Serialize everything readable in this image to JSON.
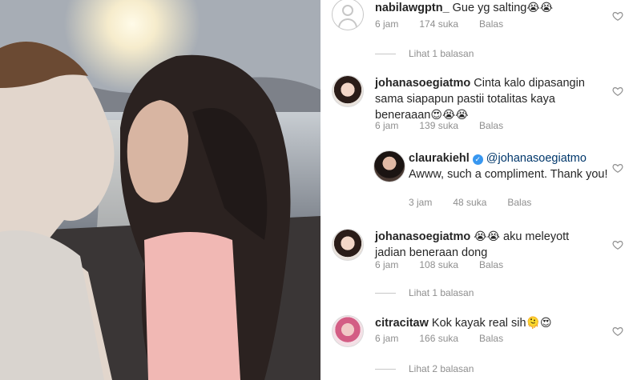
{
  "comments": [
    {
      "username": "nabilawgptn_",
      "text": "Gue yg salting",
      "emoji": "😭😭",
      "time": "6 jam",
      "likes": "174 suka",
      "reply": "Balas",
      "view_replies": "Lihat 1 balasan"
    },
    {
      "username": "johanasoegiatmo",
      "text": "Cinta kalo dipasangin sama siapapun pastii totalitas kaya beneraaan",
      "emoji": "😍😭😭",
      "time": "6 jam",
      "likes": "139 suka",
      "reply": "Balas"
    },
    {
      "username": "claurakiehl",
      "mention": "@johanasoegiatmo",
      "text": "Awww, such a compliment. Thank you!",
      "time": "3 jam",
      "likes": "48 suka",
      "reply": "Balas"
    },
    {
      "username": "johanasoegiatmo",
      "emoji": "😭😭",
      "text": "aku meleyott jadian beneraan dong",
      "time": "6 jam",
      "likes": "108 suka",
      "reply": "Balas",
      "view_replies": "Lihat 1 balasan"
    },
    {
      "username": "citracitaw",
      "text": "Kok kayak real sih",
      "emoji": "🫠😍",
      "time": "6 jam",
      "likes": "166 suka",
      "reply": "Balas",
      "view_replies": "Lihat 2 balasan"
    }
  ],
  "icons": {
    "like": "heart-outline-icon",
    "verified": "verified-badge-icon"
  },
  "colors": {
    "text": "#262626",
    "muted": "#8e8e8e",
    "mention": "#00376b",
    "verified": "#3897f0"
  }
}
